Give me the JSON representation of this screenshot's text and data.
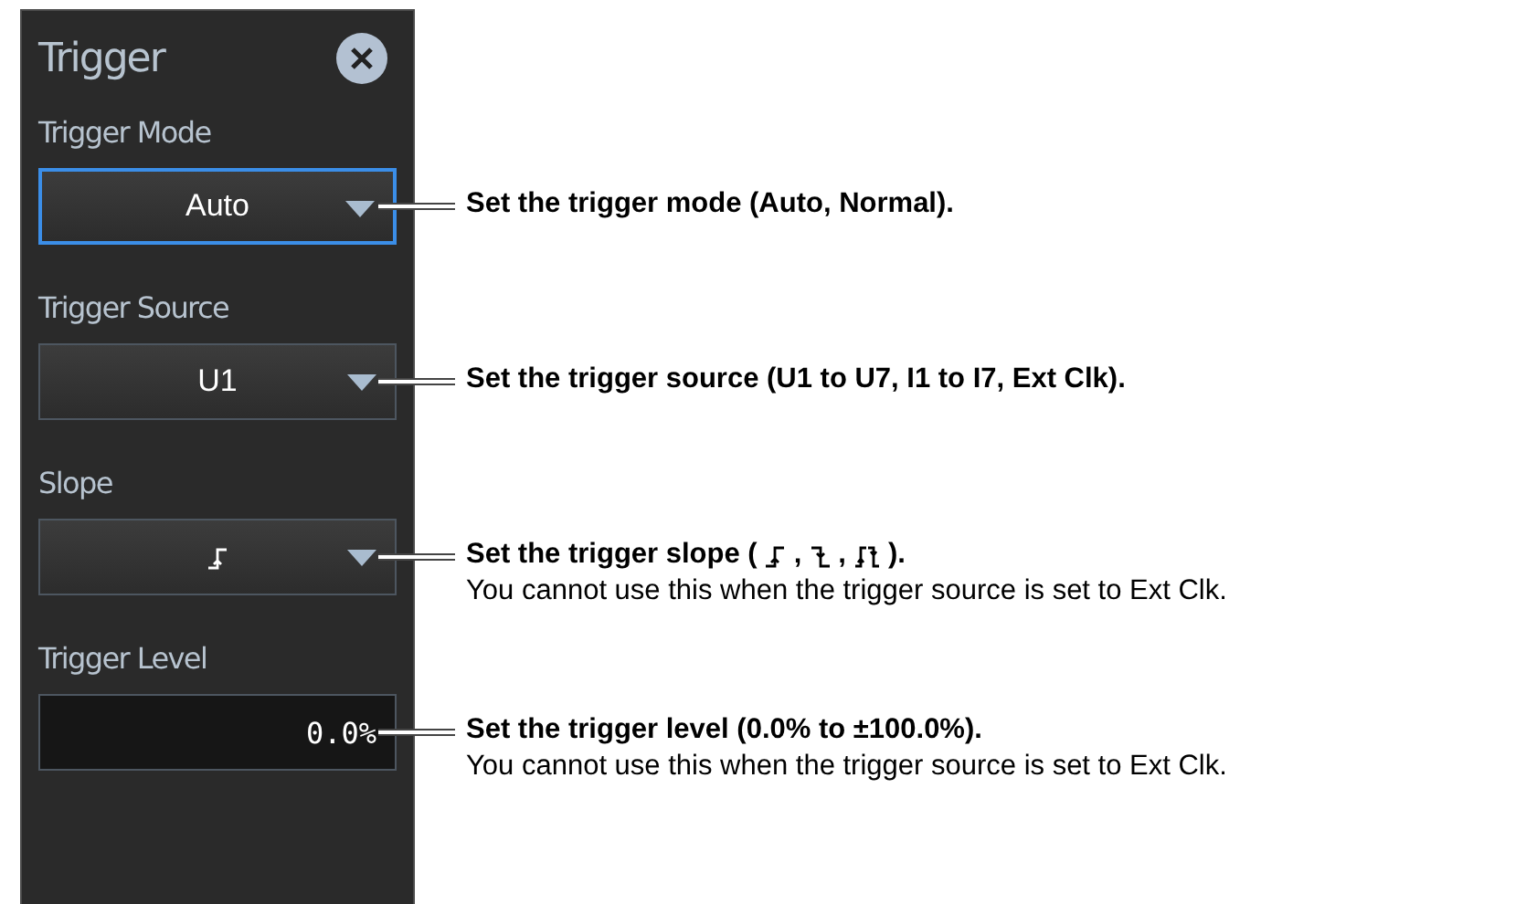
{
  "panel": {
    "title": "Trigger",
    "controls": [
      {
        "label": "Trigger Mode",
        "kind": "dropdown",
        "value": "Auto",
        "focused": true,
        "description": [
          {
            "kind": "text",
            "text": "Set the trigger mode (Auto, Normal)."
          }
        ]
      },
      {
        "label": "Trigger Source",
        "kind": "dropdown",
        "value": "U1",
        "focused": false,
        "description": [
          {
            "kind": "text",
            "text": "Set the trigger source (U1 to U7, I1 to I7, Ext Clk)."
          }
        ]
      },
      {
        "label": "Slope",
        "kind": "slope-dropdown",
        "shown": {
          "kind": "rising"
        },
        "focused": false,
        "description": [
          {
            "kind": "text",
            "text": "Set the trigger slope ("
          },
          {
            "kind": "rising"
          },
          {
            "kind": "text",
            "text": ","
          },
          {
            "kind": "falling"
          },
          {
            "kind": "text",
            "text": ","
          },
          {
            "kind": "both"
          },
          {
            "kind": "text",
            "text": ")."
          }
        ],
        "note": "You cannot use this when the trigger source is set to Ext Clk."
      },
      {
        "label": "Trigger Level",
        "kind": "field",
        "value": "0.0%",
        "focused": false,
        "description": [
          {
            "kind": "text",
            "text": "Set the trigger level (0.0% to ±100.0%)."
          }
        ],
        "note": "You cannot use this when the trigger source is set to Ext Clk."
      }
    ]
  }
}
